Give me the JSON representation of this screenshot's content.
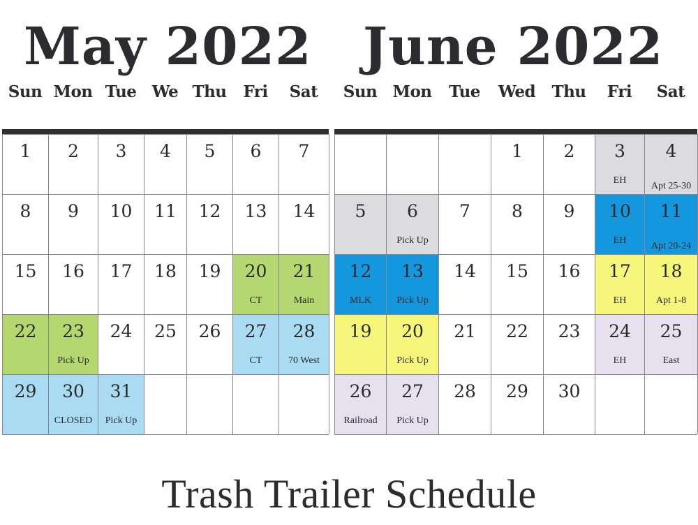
{
  "footer_title": "Trash Trailer Schedule",
  "colors": {
    "green": "#b5d770",
    "light_blue": "#a9dcf2",
    "gray": "#dcdcde",
    "blue": "#1497dc",
    "yellow": "#f6f77a",
    "lavender": "#e6e0ef",
    "white": "#ffffff"
  },
  "months": [
    {
      "id": "may",
      "title": "May 2022",
      "weekdays": [
        "Sun",
        "Mon",
        "Tue",
        "We",
        "Thu",
        "Fri",
        "Sat"
      ],
      "cells": [
        {
          "day": "1",
          "note": "",
          "color": "white"
        },
        {
          "day": "2",
          "note": "",
          "color": "white"
        },
        {
          "day": "3",
          "note": "",
          "color": "white"
        },
        {
          "day": "4",
          "note": "",
          "color": "white"
        },
        {
          "day": "5",
          "note": "",
          "color": "white"
        },
        {
          "day": "6",
          "note": "",
          "color": "white"
        },
        {
          "day": "7",
          "note": "",
          "color": "white"
        },
        {
          "day": "8",
          "note": "",
          "color": "white"
        },
        {
          "day": "9",
          "note": "",
          "color": "white"
        },
        {
          "day": "10",
          "note": "",
          "color": "white"
        },
        {
          "day": "11",
          "note": "",
          "color": "white"
        },
        {
          "day": "12",
          "note": "",
          "color": "white"
        },
        {
          "day": "13",
          "note": "",
          "color": "white"
        },
        {
          "day": "14",
          "note": "",
          "color": "white"
        },
        {
          "day": "15",
          "note": "",
          "color": "white"
        },
        {
          "day": "16",
          "note": "",
          "color": "white"
        },
        {
          "day": "17",
          "note": "",
          "color": "white"
        },
        {
          "day": "18",
          "note": "",
          "color": "white"
        },
        {
          "day": "19",
          "note": "",
          "color": "white"
        },
        {
          "day": "20",
          "note": "CT",
          "color": "green"
        },
        {
          "day": "21",
          "note": "Main",
          "color": "green"
        },
        {
          "day": "22",
          "note": "",
          "color": "green"
        },
        {
          "day": "23",
          "note": "Pick Up",
          "color": "green"
        },
        {
          "day": "24",
          "note": "",
          "color": "white"
        },
        {
          "day": "25",
          "note": "",
          "color": "white"
        },
        {
          "day": "26",
          "note": "",
          "color": "white"
        },
        {
          "day": "27",
          "note": "CT",
          "color": "light_blue"
        },
        {
          "day": "28",
          "note": "70 West",
          "color": "light_blue"
        },
        {
          "day": "29",
          "note": "",
          "color": "light_blue"
        },
        {
          "day": "30",
          "note": "CLOSED",
          "color": "light_blue"
        },
        {
          "day": "31",
          "note": "Pick Up",
          "color": "light_blue"
        },
        {
          "day": "",
          "note": "",
          "color": "white"
        },
        {
          "day": "",
          "note": "",
          "color": "white"
        },
        {
          "day": "",
          "note": "",
          "color": "white"
        },
        {
          "day": "",
          "note": "",
          "color": "white"
        }
      ]
    },
    {
      "id": "june",
      "title": "June 2022",
      "weekdays": [
        "Sun",
        "Mon",
        "Tue",
        "Wed",
        "Thu",
        "Fri",
        "Sat"
      ],
      "cells": [
        {
          "day": "",
          "note": "",
          "color": "white"
        },
        {
          "day": "",
          "note": "",
          "color": "white"
        },
        {
          "day": "",
          "note": "",
          "color": "white"
        },
        {
          "day": "1",
          "note": "",
          "color": "white"
        },
        {
          "day": "2",
          "note": "",
          "color": "white"
        },
        {
          "day": "3",
          "note": "EH",
          "color": "gray"
        },
        {
          "day": "4",
          "note": "Apt 25-30",
          "color": "gray"
        },
        {
          "day": "5",
          "note": "",
          "color": "gray"
        },
        {
          "day": "6",
          "note": "Pick Up",
          "color": "gray"
        },
        {
          "day": "7",
          "note": "",
          "color": "white"
        },
        {
          "day": "8",
          "note": "",
          "color": "white"
        },
        {
          "day": "9",
          "note": "",
          "color": "white"
        },
        {
          "day": "10",
          "note": "EH",
          "color": "blue"
        },
        {
          "day": "11",
          "note": "Apt 20-24",
          "color": "blue"
        },
        {
          "day": "12",
          "note": "MLK",
          "color": "blue"
        },
        {
          "day": "13",
          "note": "Pick Up",
          "color": "blue"
        },
        {
          "day": "14",
          "note": "",
          "color": "white"
        },
        {
          "day": "15",
          "note": "",
          "color": "white"
        },
        {
          "day": "16",
          "note": "",
          "color": "white"
        },
        {
          "day": "17",
          "note": "EH",
          "color": "yellow"
        },
        {
          "day": "18",
          "note": "Apt 1-8",
          "color": "yellow"
        },
        {
          "day": "19",
          "note": "",
          "color": "yellow"
        },
        {
          "day": "20",
          "note": "Pick Up",
          "color": "yellow"
        },
        {
          "day": "21",
          "note": "",
          "color": "white"
        },
        {
          "day": "22",
          "note": "",
          "color": "white"
        },
        {
          "day": "23",
          "note": "",
          "color": "white"
        },
        {
          "day": "24",
          "note": "EH",
          "color": "lavender"
        },
        {
          "day": "25",
          "note": "East",
          "color": "lavender"
        },
        {
          "day": "26",
          "note": "Railroad",
          "color": "lavender"
        },
        {
          "day": "27",
          "note": "Pick Up",
          "color": "lavender"
        },
        {
          "day": "28",
          "note": "",
          "color": "white"
        },
        {
          "day": "29",
          "note": "",
          "color": "white"
        },
        {
          "day": "30",
          "note": "",
          "color": "white"
        },
        {
          "day": "",
          "note": "",
          "color": "white"
        },
        {
          "day": "",
          "note": "",
          "color": "white"
        }
      ]
    }
  ]
}
